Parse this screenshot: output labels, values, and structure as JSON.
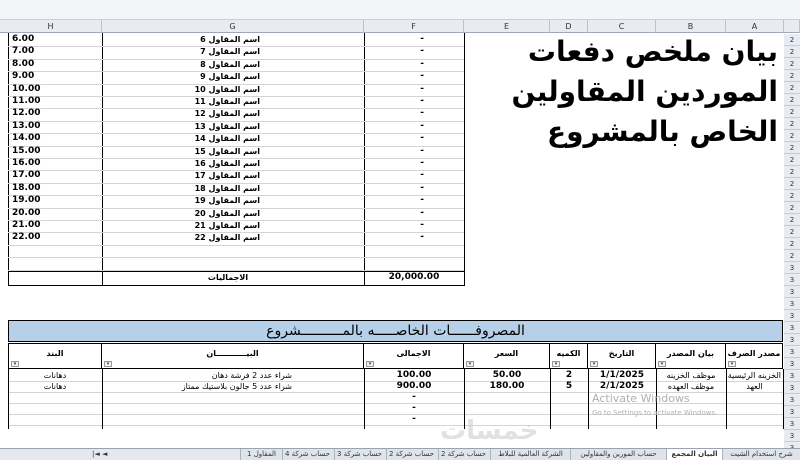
{
  "columns": {
    "H": "H",
    "G": "G",
    "F": "F",
    "E": "E",
    "D": "D",
    "C": "C",
    "B": "B",
    "A": "A"
  },
  "row_numbers": [
    "2",
    "2",
    "2",
    "2",
    "2",
    "2",
    "2",
    "2",
    "2",
    "2",
    "2",
    "2",
    "2",
    "2",
    "2",
    "2",
    "2",
    "2",
    "2",
    "3",
    "3",
    "3",
    "3",
    "3",
    "3",
    "3",
    "3",
    "3",
    "3",
    "3",
    "3",
    "3",
    "3",
    "3",
    "3",
    "3",
    "3"
  ],
  "title": "بيان ملخص دفعات الموردين المقاولين الخاص بالمشروع",
  "contractors": [
    {
      "num": "6.00",
      "name": "اسم المقاول 6",
      "amount": "-"
    },
    {
      "num": "7.00",
      "name": "اسم المقاول 7",
      "amount": "-"
    },
    {
      "num": "8.00",
      "name": "اسم المقاول 8",
      "amount": "-"
    },
    {
      "num": "9.00",
      "name": "اسم المقاول 9",
      "amount": "-"
    },
    {
      "num": "10.00",
      "name": "اسم المقاول 10",
      "amount": "-"
    },
    {
      "num": "11.00",
      "name": "اسم المقاول 11",
      "amount": "-"
    },
    {
      "num": "12.00",
      "name": "اسم المقاول 12",
      "amount": "-"
    },
    {
      "num": "13.00",
      "name": "اسم المقاول 13",
      "amount": "-"
    },
    {
      "num": "14.00",
      "name": "اسم المقاول 14",
      "amount": "-"
    },
    {
      "num": "15.00",
      "name": "اسم المقاول 15",
      "amount": "-"
    },
    {
      "num": "16.00",
      "name": "اسم المقاول 16",
      "amount": "-"
    },
    {
      "num": "17.00",
      "name": "اسم المقاول 17",
      "amount": "-"
    },
    {
      "num": "18.00",
      "name": "اسم المقاول 18",
      "amount": "-"
    },
    {
      "num": "19.00",
      "name": "اسم المقاول 19",
      "amount": "-"
    },
    {
      "num": "20.00",
      "name": "اسم المقاول 20",
      "amount": "-"
    },
    {
      "num": "21.00",
      "name": "اسم المقاول 21",
      "amount": "-"
    },
    {
      "num": "22.00",
      "name": "اسم المقاول 22",
      "amount": "-"
    }
  ],
  "totals": {
    "label": "الاجماليات",
    "value": "20,000.00"
  },
  "expenses": {
    "banner": "المصروفــــــات الخاصـــــه بالمــــــــــشروع",
    "headers": {
      "item": "البند",
      "statement": "البيـــــــــــان",
      "total": "الاجمالى",
      "price": "السعر",
      "qty": "الكميه",
      "date": "التاريخ",
      "source": "بيان المصدر",
      "payment": "مصدر الصرف"
    },
    "rows": [
      {
        "item": "دهانات",
        "statement": "شراء عدد 2 فرشة دهان",
        "total": "100.00",
        "price": "50.00",
        "qty": "2",
        "date": "1/1/2025",
        "source": "موظف الخزينه",
        "payment": "الخزينه الرئيسية"
      },
      {
        "item": "دهانات",
        "statement": "شراء عدد 5 جالون بلاستيك ممتاز",
        "total": "900.00",
        "price": "180.00",
        "qty": "5",
        "date": "2/1/2025",
        "source": "موظف العهده",
        "payment": "العهد"
      },
      {
        "item": "",
        "statement": "",
        "total": "-",
        "price": "",
        "qty": "",
        "date": "",
        "source": "",
        "payment": ""
      },
      {
        "item": "",
        "statement": "",
        "total": "-",
        "price": "",
        "qty": "",
        "date": "",
        "source": "",
        "payment": ""
      },
      {
        "item": "",
        "statement": "",
        "total": "-",
        "price": "",
        "qty": "",
        "date": "",
        "source": "",
        "payment": ""
      }
    ]
  },
  "watermark": {
    "line1": "Activate Windows",
    "line2": "Go to Settings to activate Windows."
  },
  "logo_text": "خمسات",
  "sheet_tabs": [
    "شرح استخدام الشيت",
    "البيان المجمع",
    "حساب المورين والمقاولين",
    "الشركة العالمية للبلاط",
    "حساب شركة 2",
    "حساب شركة 2",
    "حساب شركة 3",
    "حساب شركة 4",
    "المقاول 1"
  ],
  "tab_nav": "|◄ ◄",
  "colors": {
    "banner": "#b7d0ea",
    "header_bg": "#e8ecf2"
  }
}
